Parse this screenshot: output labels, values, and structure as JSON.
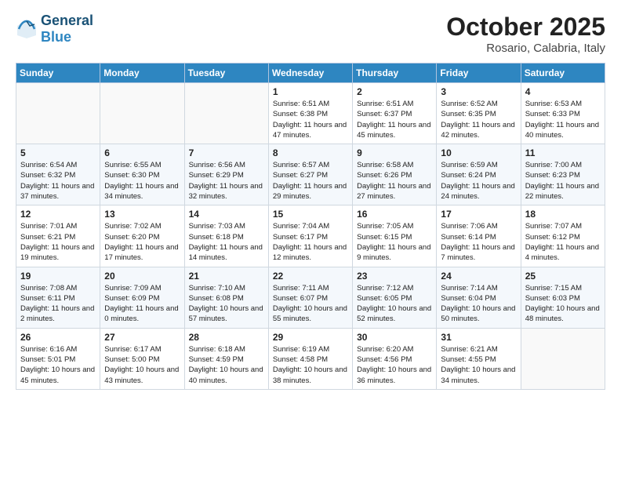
{
  "header": {
    "logo_line1": "General",
    "logo_line2": "Blue",
    "month": "October 2025",
    "location": "Rosario, Calabria, Italy"
  },
  "weekdays": [
    "Sunday",
    "Monday",
    "Tuesday",
    "Wednesday",
    "Thursday",
    "Friday",
    "Saturday"
  ],
  "weeks": [
    [
      {
        "day": "",
        "text": ""
      },
      {
        "day": "",
        "text": ""
      },
      {
        "day": "",
        "text": ""
      },
      {
        "day": "1",
        "text": "Sunrise: 6:51 AM\nSunset: 6:38 PM\nDaylight: 11 hours and 47 minutes."
      },
      {
        "day": "2",
        "text": "Sunrise: 6:51 AM\nSunset: 6:37 PM\nDaylight: 11 hours and 45 minutes."
      },
      {
        "day": "3",
        "text": "Sunrise: 6:52 AM\nSunset: 6:35 PM\nDaylight: 11 hours and 42 minutes."
      },
      {
        "day": "4",
        "text": "Sunrise: 6:53 AM\nSunset: 6:33 PM\nDaylight: 11 hours and 40 minutes."
      }
    ],
    [
      {
        "day": "5",
        "text": "Sunrise: 6:54 AM\nSunset: 6:32 PM\nDaylight: 11 hours and 37 minutes."
      },
      {
        "day": "6",
        "text": "Sunrise: 6:55 AM\nSunset: 6:30 PM\nDaylight: 11 hours and 34 minutes."
      },
      {
        "day": "7",
        "text": "Sunrise: 6:56 AM\nSunset: 6:29 PM\nDaylight: 11 hours and 32 minutes."
      },
      {
        "day": "8",
        "text": "Sunrise: 6:57 AM\nSunset: 6:27 PM\nDaylight: 11 hours and 29 minutes."
      },
      {
        "day": "9",
        "text": "Sunrise: 6:58 AM\nSunset: 6:26 PM\nDaylight: 11 hours and 27 minutes."
      },
      {
        "day": "10",
        "text": "Sunrise: 6:59 AM\nSunset: 6:24 PM\nDaylight: 11 hours and 24 minutes."
      },
      {
        "day": "11",
        "text": "Sunrise: 7:00 AM\nSunset: 6:23 PM\nDaylight: 11 hours and 22 minutes."
      }
    ],
    [
      {
        "day": "12",
        "text": "Sunrise: 7:01 AM\nSunset: 6:21 PM\nDaylight: 11 hours and 19 minutes."
      },
      {
        "day": "13",
        "text": "Sunrise: 7:02 AM\nSunset: 6:20 PM\nDaylight: 11 hours and 17 minutes."
      },
      {
        "day": "14",
        "text": "Sunrise: 7:03 AM\nSunset: 6:18 PM\nDaylight: 11 hours and 14 minutes."
      },
      {
        "day": "15",
        "text": "Sunrise: 7:04 AM\nSunset: 6:17 PM\nDaylight: 11 hours and 12 minutes."
      },
      {
        "day": "16",
        "text": "Sunrise: 7:05 AM\nSunset: 6:15 PM\nDaylight: 11 hours and 9 minutes."
      },
      {
        "day": "17",
        "text": "Sunrise: 7:06 AM\nSunset: 6:14 PM\nDaylight: 11 hours and 7 minutes."
      },
      {
        "day": "18",
        "text": "Sunrise: 7:07 AM\nSunset: 6:12 PM\nDaylight: 11 hours and 4 minutes."
      }
    ],
    [
      {
        "day": "19",
        "text": "Sunrise: 7:08 AM\nSunset: 6:11 PM\nDaylight: 11 hours and 2 minutes."
      },
      {
        "day": "20",
        "text": "Sunrise: 7:09 AM\nSunset: 6:09 PM\nDaylight: 11 hours and 0 minutes."
      },
      {
        "day": "21",
        "text": "Sunrise: 7:10 AM\nSunset: 6:08 PM\nDaylight: 10 hours and 57 minutes."
      },
      {
        "day": "22",
        "text": "Sunrise: 7:11 AM\nSunset: 6:07 PM\nDaylight: 10 hours and 55 minutes."
      },
      {
        "day": "23",
        "text": "Sunrise: 7:12 AM\nSunset: 6:05 PM\nDaylight: 10 hours and 52 minutes."
      },
      {
        "day": "24",
        "text": "Sunrise: 7:14 AM\nSunset: 6:04 PM\nDaylight: 10 hours and 50 minutes."
      },
      {
        "day": "25",
        "text": "Sunrise: 7:15 AM\nSunset: 6:03 PM\nDaylight: 10 hours and 48 minutes."
      }
    ],
    [
      {
        "day": "26",
        "text": "Sunrise: 6:16 AM\nSunset: 5:01 PM\nDaylight: 10 hours and 45 minutes."
      },
      {
        "day": "27",
        "text": "Sunrise: 6:17 AM\nSunset: 5:00 PM\nDaylight: 10 hours and 43 minutes."
      },
      {
        "day": "28",
        "text": "Sunrise: 6:18 AM\nSunset: 4:59 PM\nDaylight: 10 hours and 40 minutes."
      },
      {
        "day": "29",
        "text": "Sunrise: 6:19 AM\nSunset: 4:58 PM\nDaylight: 10 hours and 38 minutes."
      },
      {
        "day": "30",
        "text": "Sunrise: 6:20 AM\nSunset: 4:56 PM\nDaylight: 10 hours and 36 minutes."
      },
      {
        "day": "31",
        "text": "Sunrise: 6:21 AM\nSunset: 4:55 PM\nDaylight: 10 hours and 34 minutes."
      },
      {
        "day": "",
        "text": ""
      }
    ]
  ]
}
